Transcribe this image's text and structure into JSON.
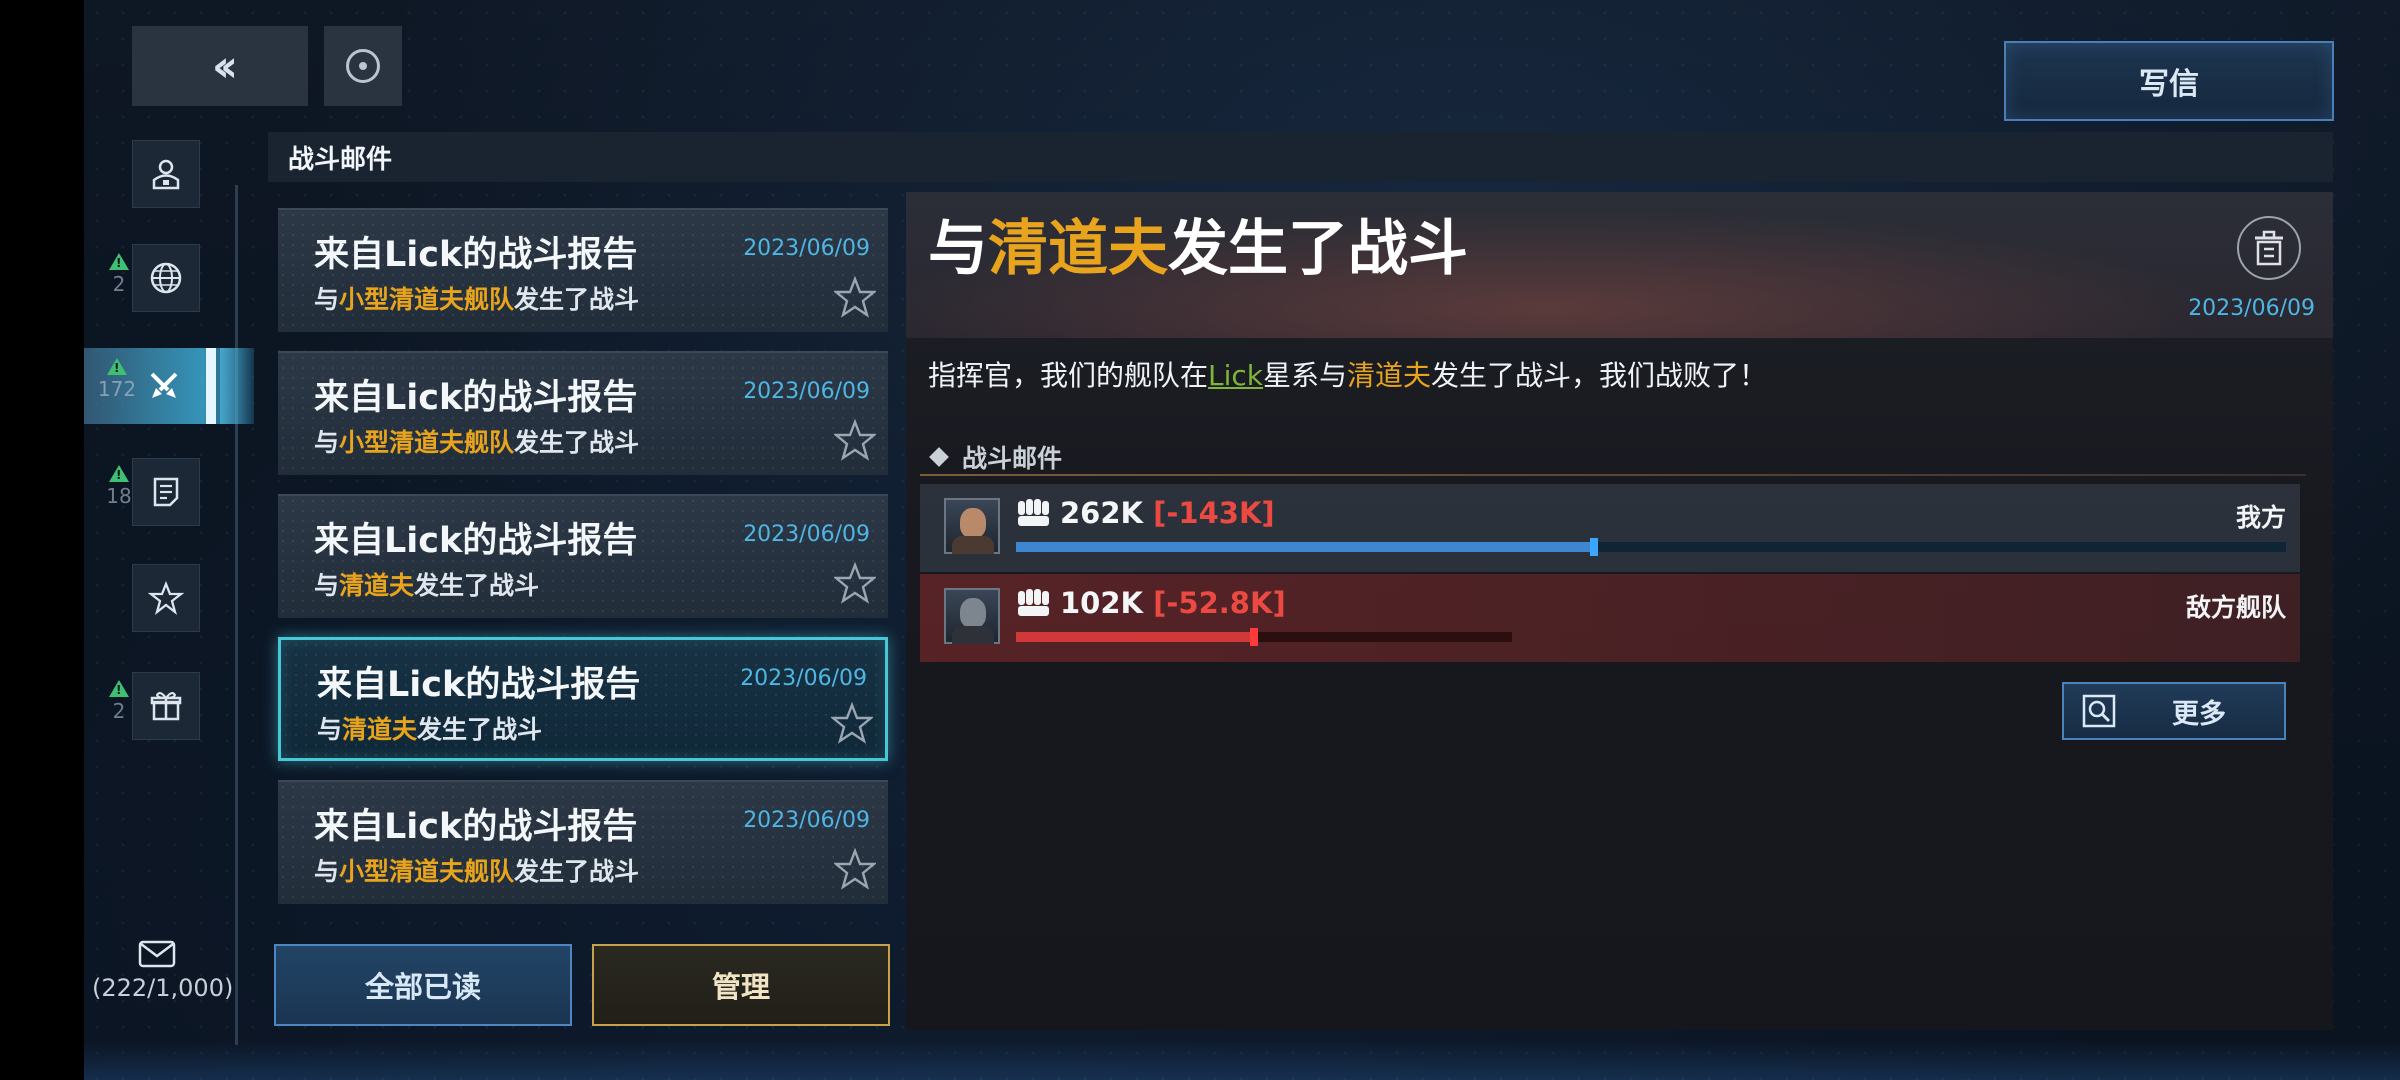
{
  "header": {
    "back_icon": "double-chevron-left-icon",
    "refresh_icon": "circle-dot-icon",
    "write_label": "写信"
  },
  "sidebar": {
    "items": [
      {
        "icon": "person-icon",
        "badge": ""
      },
      {
        "icon": "globe-icon",
        "badge": "2"
      },
      {
        "icon": "battle-swords-icon",
        "badge": "172"
      },
      {
        "icon": "document-icon",
        "badge": "18"
      },
      {
        "icon": "star-icon",
        "badge": ""
      },
      {
        "icon": "gift-icon",
        "badge": "2"
      }
    ],
    "mail_count": "(222/1,000)"
  },
  "section_title": "战斗邮件",
  "mail_list": [
    {
      "title": "来自Lick的战斗报告",
      "date": "2023/06/09",
      "sub_pre": "与",
      "sub_hl": "小型清道夫舰队",
      "sub_post": "发生了战斗"
    },
    {
      "title": "来自Lick的战斗报告",
      "date": "2023/06/09",
      "sub_pre": "与",
      "sub_hl": "小型清道夫舰队",
      "sub_post": "发生了战斗"
    },
    {
      "title": "来自Lick的战斗报告",
      "date": "2023/06/09",
      "sub_pre": "与",
      "sub_hl": "清道夫",
      "sub_post": "发生了战斗"
    },
    {
      "title": "来自Lick的战斗报告",
      "date": "2023/06/09",
      "sub_pre": "与",
      "sub_hl": "清道夫",
      "sub_post": "发生了战斗"
    },
    {
      "title": "来自Lick的战斗报告",
      "date": "2023/06/09",
      "sub_pre": "与",
      "sub_hl": "小型清道夫舰队",
      "sub_post": "发生了战斗"
    }
  ],
  "actions": {
    "read_all": "全部已读",
    "manage": "管理"
  },
  "detail": {
    "title_pre": "与",
    "title_hl": "清道夫",
    "title_post": "发生了战斗",
    "date": "2023/06/09",
    "msg_1": "指挥官，我们的舰队在",
    "msg_link": "Lick",
    "msg_2": "星系与",
    "msg_hl": "清道夫",
    "msg_3": "发生了战斗，我们战败了！",
    "section": "战斗邮件",
    "ours": {
      "power": "262K",
      "loss": "[-143K]",
      "label": "我方",
      "bar_fill": 0.455
    },
    "enemy": {
      "power": "102K",
      "loss": "[-52.8K]",
      "label": "敌方舰队",
      "bar_fill": 0.48
    },
    "more": "更多"
  },
  "colors": {
    "accent_blue": "#4fb6e4",
    "highlight_gold": "#e8a41c",
    "loss_red": "#ea4a42",
    "link_green": "#7fb53a",
    "ours_bar": "#3f86d0",
    "enemy_bar": "#d0383a"
  }
}
